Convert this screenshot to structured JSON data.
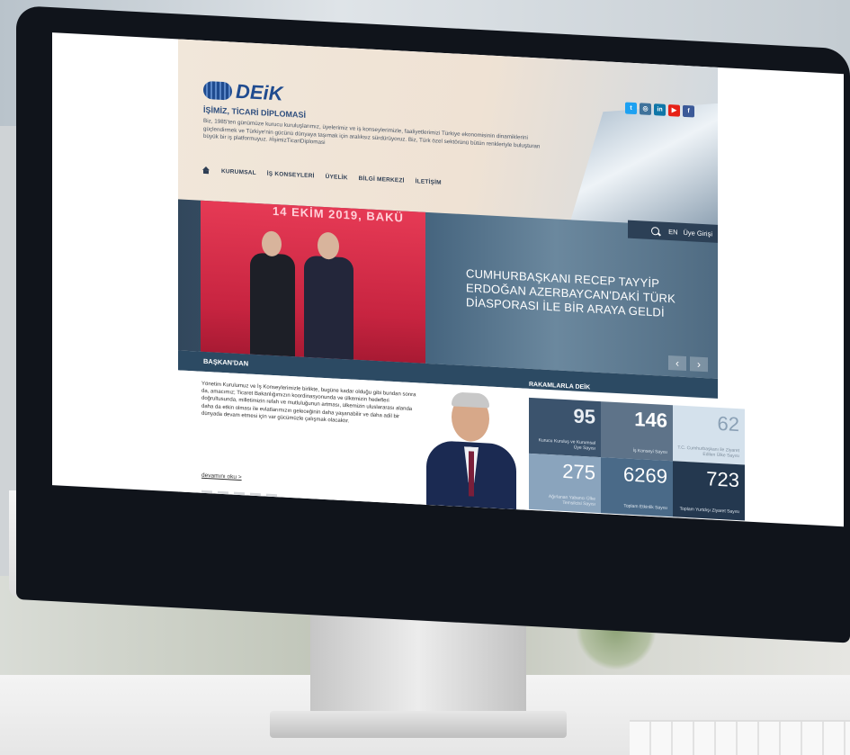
{
  "site": {
    "logo_text": "DEiK",
    "tagline": "İŞİMİZ, TİCARİ DİPLOMASİ",
    "description": "Biz, 1985'ten günümüze kurucu kuruluşlarımız, üyelerimiz ve iş konseylerimizle, faaliyetlerimizi Türkiye ekonomisinin dinamiklerini güçlendirmek ve Türkiye'nin gücünü dünyaya taşımak için aralıksız sürdürüyoruz. Biz, Türk özel sektörünü bütün renkleriyle buluşturan büyük bir iş platformuyuz. #İşimizTicariDiplomasi",
    "social": [
      {
        "icon": "twitter-icon",
        "glyph": "t",
        "color": "#1da1f2"
      },
      {
        "icon": "instagram-icon",
        "glyph": "◎",
        "color": "#3f729b"
      },
      {
        "icon": "linkedin-icon",
        "glyph": "in",
        "color": "#0e76a8"
      },
      {
        "icon": "youtube-icon",
        "glyph": "▶",
        "color": "#e62117"
      },
      {
        "icon": "facebook-icon",
        "glyph": "f",
        "color": "#3b5998"
      }
    ],
    "nav": [
      "KURUMSAL",
      "İŞ KONSEYLERİ",
      "ÜYELİK",
      "BİLGİ MERKEZİ",
      "İLETİŞİM"
    ],
    "util": {
      "lang": "EN",
      "login": "Üye Girişi"
    }
  },
  "slider": {
    "date_text": "14 EKİM 2019, BAKÜ",
    "caption": "CUMHURBAŞKANI RECEP TAYYİP ERDOĞAN AZERBAYCAN'DAKİ TÜRK DİASPORASI İLE BİR ARAYA GELDİ",
    "prev": "‹",
    "next": "›"
  },
  "baskan": {
    "heading": "BAŞKAN'DAN",
    "text": "Yönetim Kurulumuz ve İş Konseylerimizle birlikte, bugüne kadar olduğu gibi bundan sonra da, amacımız; Ticaret Bakanlığımızın koordinasyonunda ve ülkemizin hedefleri doğrultusunda, milletimizin refah ve mutluluğunun artması, ülkemizin uluslararası alanda daha da etkin olması ile evlatlarımızın geleceğinin daha yaşanabilir ve daha adil bir dünyada devam etmesi için var gücümüzle çalışmak olacaktır.",
    "more": "devamını oku >"
  },
  "stats": {
    "heading": "RAKAMLARLA DEİK",
    "items": [
      {
        "value": "95",
        "label": "Kurucu Kuruluş ve Kurumsal Üye Sayısı"
      },
      {
        "value": "146",
        "label": "İş Konseyi Sayısı"
      },
      {
        "value": "62",
        "label": "T.C. Cumhurbaşkanı ile Ziyaret Edilen Ülke Sayısı"
      },
      {
        "value": "275",
        "label": "Ağırlanan Yabancı Ülke Temsilcisi Sayısı"
      },
      {
        "value": "6269",
        "label": "Toplam Etkinlik Sayısı"
      },
      {
        "value": "723",
        "label": "Toplam Yurtdışı Ziyaret Sayısı"
      }
    ]
  }
}
